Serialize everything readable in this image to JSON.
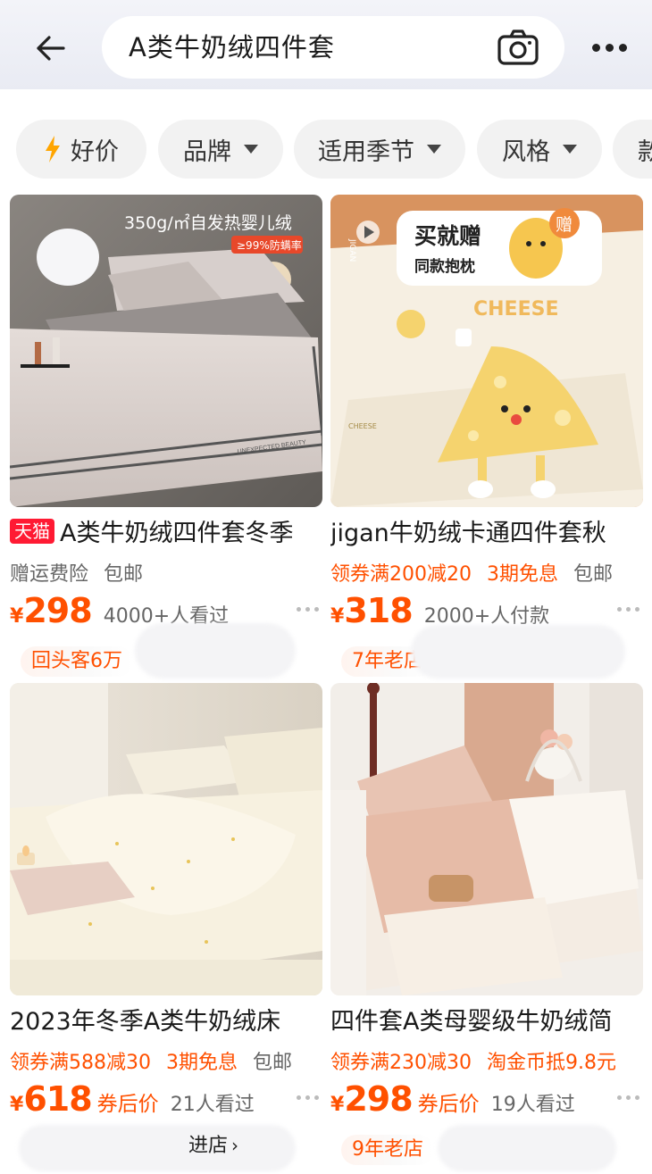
{
  "header": {
    "search_query": "A类牛奶绒四件套"
  },
  "filters": [
    {
      "label": "好价",
      "icon": "lightning-icon"
    },
    {
      "label": "品牌",
      "icon": "caret-down-icon"
    },
    {
      "label": "适用季节",
      "icon": "caret-down-icon"
    },
    {
      "label": "风格",
      "icon": "caret-down-icon"
    },
    {
      "label": "款",
      "icon": ""
    }
  ],
  "products": [
    {
      "badge": "天猫",
      "image_text": "350g/㎡自发热婴儿绒",
      "image_subtext": "≥99%防螨率",
      "title": "A类牛奶绒四件套冬季",
      "promos": [
        {
          "text": "赠运费险",
          "style": "grey"
        },
        {
          "text": "包邮",
          "style": "grey"
        }
      ],
      "price_symbol": "¥",
      "price": "298",
      "price_suffix": "",
      "sold": "4000+人看过",
      "tag": "回头客6万"
    },
    {
      "badge": "",
      "image_text": "买就赠",
      "image_subtext": "同款抱枕",
      "image_corner": "赠",
      "image_logo": "CHEESE",
      "title": "jigan牛奶绒卡通四件套秋",
      "promos": [
        {
          "text": "领券满200减20",
          "style": "orange"
        },
        {
          "text": "3期免息",
          "style": "orange"
        },
        {
          "text": "包邮",
          "style": "grey"
        }
      ],
      "price_symbol": "¥",
      "price": "318",
      "price_suffix": "",
      "sold": "2000+人付款",
      "tag": "7年老店"
    },
    {
      "badge": "",
      "title": "2023年冬季A类牛奶绒床",
      "promos": [
        {
          "text": "领券满588减30",
          "style": "orange"
        },
        {
          "text": "3期免息",
          "style": "orange"
        },
        {
          "text": "包邮",
          "style": "grey"
        }
      ],
      "price_symbol": "¥",
      "price": "618",
      "price_suffix": "券后价",
      "sold": "21人看过",
      "store_link": "进店"
    },
    {
      "badge": "",
      "title": "四件套A类母婴级牛奶绒简",
      "promos": [
        {
          "text": "领券满230减30",
          "style": "orange"
        },
        {
          "text": "淘金币抵9.8元",
          "style": "orange"
        }
      ],
      "price_symbol": "¥",
      "price": "298",
      "price_suffix": "券后价",
      "sold": "19人看过",
      "tag": "9年老店"
    }
  ],
  "colors": {
    "accent": "#ff5000",
    "tmall": "#ff1a33",
    "header_bg": "#eceef5"
  }
}
